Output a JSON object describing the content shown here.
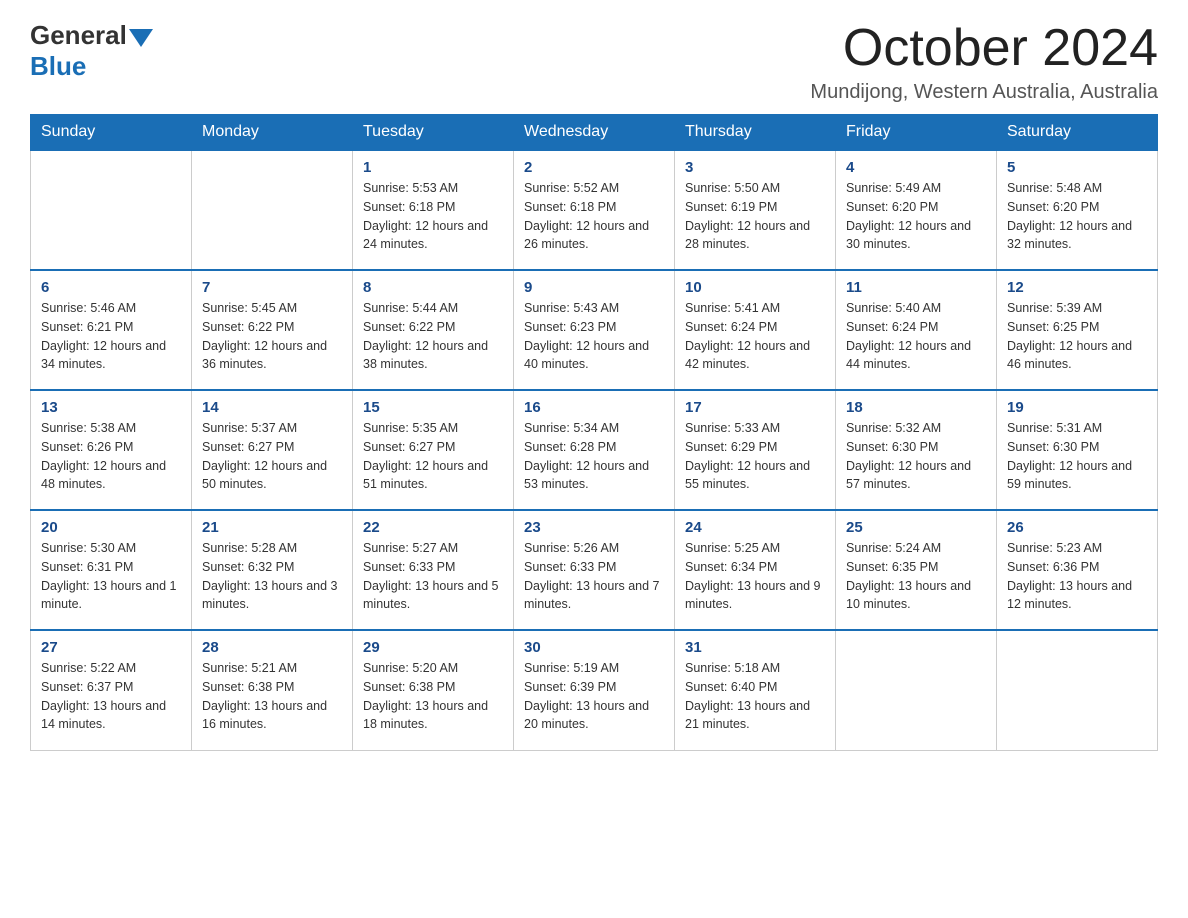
{
  "header": {
    "logo_general": "General",
    "logo_blue": "Blue",
    "month_year": "October 2024",
    "location": "Mundijong, Western Australia, Australia"
  },
  "weekdays": [
    "Sunday",
    "Monday",
    "Tuesday",
    "Wednesday",
    "Thursday",
    "Friday",
    "Saturday"
  ],
  "weeks": [
    [
      {
        "day": "",
        "sunrise": "",
        "sunset": "",
        "daylight": ""
      },
      {
        "day": "",
        "sunrise": "",
        "sunset": "",
        "daylight": ""
      },
      {
        "day": "1",
        "sunrise": "Sunrise: 5:53 AM",
        "sunset": "Sunset: 6:18 PM",
        "daylight": "Daylight: 12 hours and 24 minutes."
      },
      {
        "day": "2",
        "sunrise": "Sunrise: 5:52 AM",
        "sunset": "Sunset: 6:18 PM",
        "daylight": "Daylight: 12 hours and 26 minutes."
      },
      {
        "day": "3",
        "sunrise": "Sunrise: 5:50 AM",
        "sunset": "Sunset: 6:19 PM",
        "daylight": "Daylight: 12 hours and 28 minutes."
      },
      {
        "day": "4",
        "sunrise": "Sunrise: 5:49 AM",
        "sunset": "Sunset: 6:20 PM",
        "daylight": "Daylight: 12 hours and 30 minutes."
      },
      {
        "day": "5",
        "sunrise": "Sunrise: 5:48 AM",
        "sunset": "Sunset: 6:20 PM",
        "daylight": "Daylight: 12 hours and 32 minutes."
      }
    ],
    [
      {
        "day": "6",
        "sunrise": "Sunrise: 5:46 AM",
        "sunset": "Sunset: 6:21 PM",
        "daylight": "Daylight: 12 hours and 34 minutes."
      },
      {
        "day": "7",
        "sunrise": "Sunrise: 5:45 AM",
        "sunset": "Sunset: 6:22 PM",
        "daylight": "Daylight: 12 hours and 36 minutes."
      },
      {
        "day": "8",
        "sunrise": "Sunrise: 5:44 AM",
        "sunset": "Sunset: 6:22 PM",
        "daylight": "Daylight: 12 hours and 38 minutes."
      },
      {
        "day": "9",
        "sunrise": "Sunrise: 5:43 AM",
        "sunset": "Sunset: 6:23 PM",
        "daylight": "Daylight: 12 hours and 40 minutes."
      },
      {
        "day": "10",
        "sunrise": "Sunrise: 5:41 AM",
        "sunset": "Sunset: 6:24 PM",
        "daylight": "Daylight: 12 hours and 42 minutes."
      },
      {
        "day": "11",
        "sunrise": "Sunrise: 5:40 AM",
        "sunset": "Sunset: 6:24 PM",
        "daylight": "Daylight: 12 hours and 44 minutes."
      },
      {
        "day": "12",
        "sunrise": "Sunrise: 5:39 AM",
        "sunset": "Sunset: 6:25 PM",
        "daylight": "Daylight: 12 hours and 46 minutes."
      }
    ],
    [
      {
        "day": "13",
        "sunrise": "Sunrise: 5:38 AM",
        "sunset": "Sunset: 6:26 PM",
        "daylight": "Daylight: 12 hours and 48 minutes."
      },
      {
        "day": "14",
        "sunrise": "Sunrise: 5:37 AM",
        "sunset": "Sunset: 6:27 PM",
        "daylight": "Daylight: 12 hours and 50 minutes."
      },
      {
        "day": "15",
        "sunrise": "Sunrise: 5:35 AM",
        "sunset": "Sunset: 6:27 PM",
        "daylight": "Daylight: 12 hours and 51 minutes."
      },
      {
        "day": "16",
        "sunrise": "Sunrise: 5:34 AM",
        "sunset": "Sunset: 6:28 PM",
        "daylight": "Daylight: 12 hours and 53 minutes."
      },
      {
        "day": "17",
        "sunrise": "Sunrise: 5:33 AM",
        "sunset": "Sunset: 6:29 PM",
        "daylight": "Daylight: 12 hours and 55 minutes."
      },
      {
        "day": "18",
        "sunrise": "Sunrise: 5:32 AM",
        "sunset": "Sunset: 6:30 PM",
        "daylight": "Daylight: 12 hours and 57 minutes."
      },
      {
        "day": "19",
        "sunrise": "Sunrise: 5:31 AM",
        "sunset": "Sunset: 6:30 PM",
        "daylight": "Daylight: 12 hours and 59 minutes."
      }
    ],
    [
      {
        "day": "20",
        "sunrise": "Sunrise: 5:30 AM",
        "sunset": "Sunset: 6:31 PM",
        "daylight": "Daylight: 13 hours and 1 minute."
      },
      {
        "day": "21",
        "sunrise": "Sunrise: 5:28 AM",
        "sunset": "Sunset: 6:32 PM",
        "daylight": "Daylight: 13 hours and 3 minutes."
      },
      {
        "day": "22",
        "sunrise": "Sunrise: 5:27 AM",
        "sunset": "Sunset: 6:33 PM",
        "daylight": "Daylight: 13 hours and 5 minutes."
      },
      {
        "day": "23",
        "sunrise": "Sunrise: 5:26 AM",
        "sunset": "Sunset: 6:33 PM",
        "daylight": "Daylight: 13 hours and 7 minutes."
      },
      {
        "day": "24",
        "sunrise": "Sunrise: 5:25 AM",
        "sunset": "Sunset: 6:34 PM",
        "daylight": "Daylight: 13 hours and 9 minutes."
      },
      {
        "day": "25",
        "sunrise": "Sunrise: 5:24 AM",
        "sunset": "Sunset: 6:35 PM",
        "daylight": "Daylight: 13 hours and 10 minutes."
      },
      {
        "day": "26",
        "sunrise": "Sunrise: 5:23 AM",
        "sunset": "Sunset: 6:36 PM",
        "daylight": "Daylight: 13 hours and 12 minutes."
      }
    ],
    [
      {
        "day": "27",
        "sunrise": "Sunrise: 5:22 AM",
        "sunset": "Sunset: 6:37 PM",
        "daylight": "Daylight: 13 hours and 14 minutes."
      },
      {
        "day": "28",
        "sunrise": "Sunrise: 5:21 AM",
        "sunset": "Sunset: 6:38 PM",
        "daylight": "Daylight: 13 hours and 16 minutes."
      },
      {
        "day": "29",
        "sunrise": "Sunrise: 5:20 AM",
        "sunset": "Sunset: 6:38 PM",
        "daylight": "Daylight: 13 hours and 18 minutes."
      },
      {
        "day": "30",
        "sunrise": "Sunrise: 5:19 AM",
        "sunset": "Sunset: 6:39 PM",
        "daylight": "Daylight: 13 hours and 20 minutes."
      },
      {
        "day": "31",
        "sunrise": "Sunrise: 5:18 AM",
        "sunset": "Sunset: 6:40 PM",
        "daylight": "Daylight: 13 hours and 21 minutes."
      },
      {
        "day": "",
        "sunrise": "",
        "sunset": "",
        "daylight": ""
      },
      {
        "day": "",
        "sunrise": "",
        "sunset": "",
        "daylight": ""
      }
    ]
  ]
}
